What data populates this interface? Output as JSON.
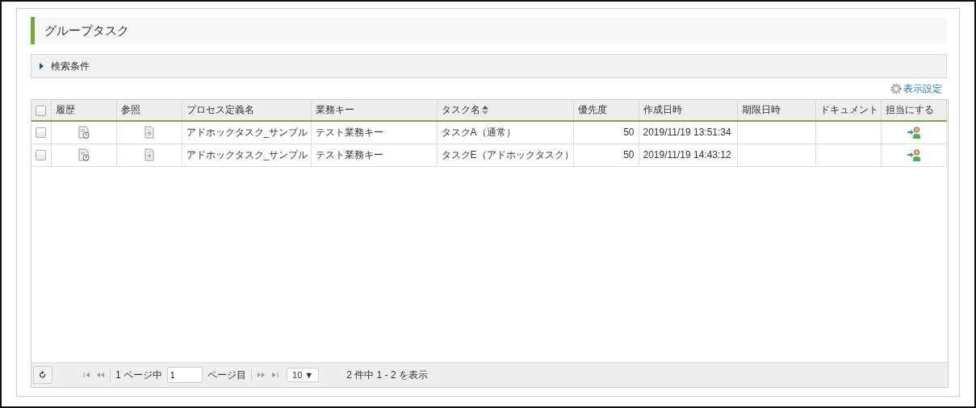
{
  "title": "グループタスク",
  "search_panel": {
    "label": "検索条件",
    "expanded": false
  },
  "display_settings": "表示設定",
  "table": {
    "select_all": {
      "checked": false
    },
    "columns": [
      {
        "label": "履歴",
        "sortable": false,
        "kind": "icon"
      },
      {
        "label": "参照",
        "sortable": false,
        "kind": "icon"
      },
      {
        "label": "プロセス定義名",
        "sortable": false,
        "kind": "text"
      },
      {
        "label": "業務キー",
        "sortable": false,
        "kind": "text"
      },
      {
        "label": "タスク名",
        "sortable": true,
        "kind": "text"
      },
      {
        "label": "優先度",
        "sortable": false,
        "kind": "number"
      },
      {
        "label": "作成日時",
        "sortable": false,
        "kind": "text"
      },
      {
        "label": "期限日時",
        "sortable": false,
        "kind": "text"
      },
      {
        "label": "ドキュメント",
        "sortable": false,
        "kind": "text"
      },
      {
        "label": "担当にする",
        "sortable": false,
        "kind": "icon"
      }
    ],
    "rows": [
      {
        "checked": false,
        "cells": [
          {
            "kind": "history"
          },
          {
            "kind": "view"
          },
          "アドホックタスク_サンプル",
          "テスト業務キー",
          "タスクA（通常）",
          "50",
          "2019/11/19 13:51:34",
          "",
          "",
          {
            "kind": "assign"
          }
        ]
      },
      {
        "checked": false,
        "cells": [
          {
            "kind": "history"
          },
          {
            "kind": "view"
          },
          "アドホックタスク_サンプル",
          "テスト業務キー",
          "タスクE（アドホックタスク）",
          "50",
          "2019/11/19 14:43:12",
          "",
          "",
          {
            "kind": "assign"
          }
        ]
      }
    ]
  },
  "pager": {
    "page_of": "1 ページ中",
    "page_value": "1",
    "page_suffix": "ページ目",
    "page_size": "10 ▼",
    "summary": "2 件中 1 - 2 を表示"
  }
}
